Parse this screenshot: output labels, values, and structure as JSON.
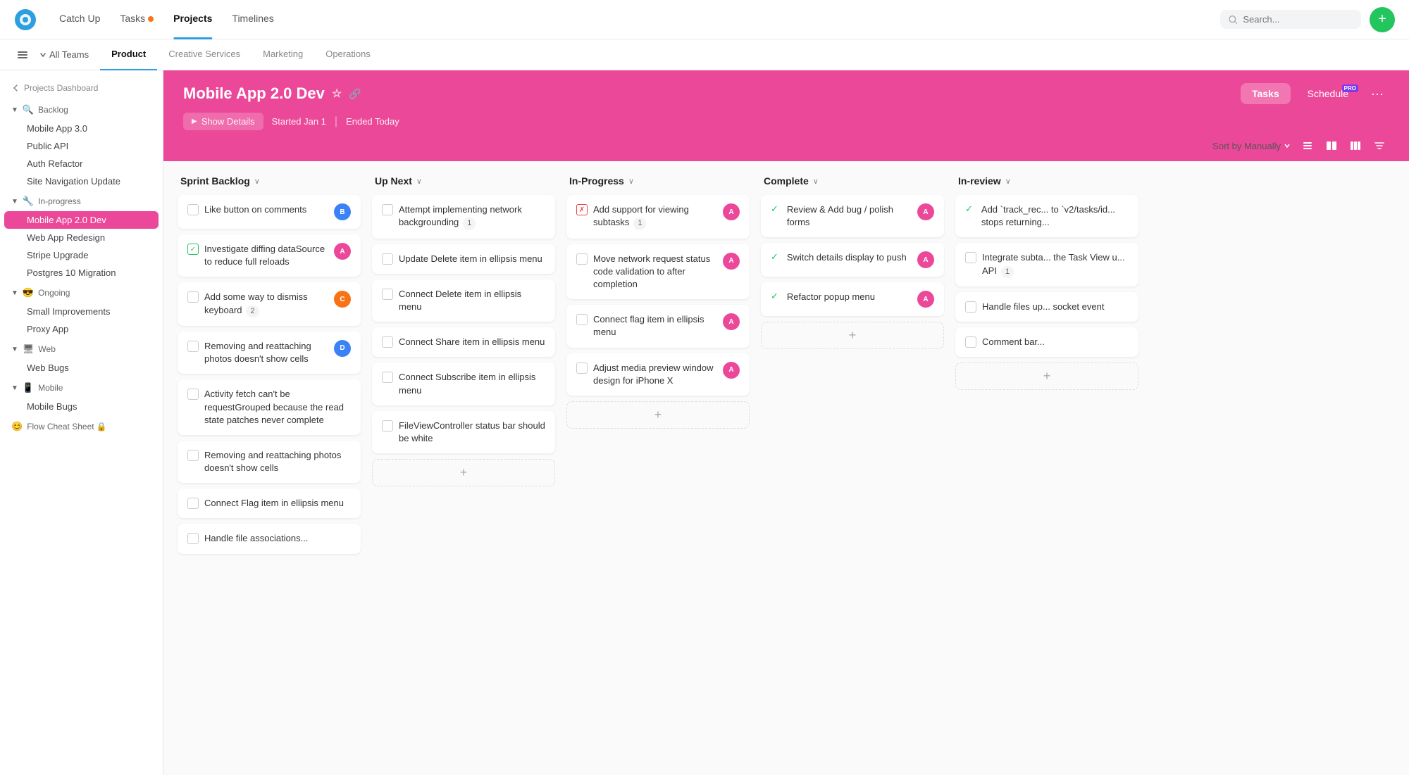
{
  "topNav": {
    "logoAlt": "app-logo",
    "links": [
      {
        "label": "Catch Up",
        "active": false,
        "badge": false
      },
      {
        "label": "Tasks",
        "active": false,
        "badge": true
      },
      {
        "label": "Projects",
        "active": true,
        "badge": false
      },
      {
        "label": "Timelines",
        "active": false,
        "badge": false
      }
    ],
    "searchPlaceholder": "Search...",
    "addButtonLabel": "+"
  },
  "teamBar": {
    "allTeamsLabel": "All Teams",
    "tabs": [
      {
        "label": "Product",
        "active": true
      },
      {
        "label": "Creative Services",
        "active": false
      },
      {
        "label": "Marketing",
        "active": false
      },
      {
        "label": "Operations",
        "active": false
      }
    ]
  },
  "sidebar": {
    "backLabel": "Projects Dashboard",
    "sections": [
      {
        "icon": "🔍",
        "label": "Backlog",
        "items": [
          "Mobile App 3.0",
          "Public API",
          "Auth Refactor",
          "Site Navigation Update"
        ]
      },
      {
        "icon": "🔧",
        "label": "In-progress",
        "items": [
          "Mobile App 2.0 Dev",
          "Web App Redesign",
          "Stripe Upgrade",
          "Postgres 10 Migration"
        ],
        "activeItem": "Mobile App 2.0 Dev"
      },
      {
        "icon": "😎",
        "label": "Ongoing",
        "items": [
          "Small Improvements",
          "Proxy App"
        ]
      },
      {
        "icon": "🖥",
        "label": "Web",
        "items": [
          "Web Bugs"
        ]
      },
      {
        "icon": "📱",
        "label": "Mobile",
        "items": [
          "Mobile Bugs"
        ]
      },
      {
        "icon": "😊",
        "label": "Flow Cheat Sheet 🔒",
        "items": []
      }
    ]
  },
  "project": {
    "title": "Mobile App 2.0 Dev",
    "startedLabel": "Started Jan 1",
    "endedLabel": "Ended Today",
    "showDetailsLabel": "Show Details",
    "tasksLabel": "Tasks",
    "scheduleLabel": "Schedule",
    "proLabel": "PRO",
    "sortLabel": "Sort by Manually"
  },
  "board": {
    "columns": [
      {
        "title": "Sprint Backlog",
        "cards": [
          {
            "text": "Like button on comments",
            "checked": false,
            "avatarColor": "#3b82f6",
            "avatarInitial": "B"
          },
          {
            "text": "Investigate diffing dataSource to reduce full reloads",
            "checked": true,
            "avatarColor": "#ec4899",
            "avatarInitial": "A"
          },
          {
            "text": "Add some way to dismiss keyboard",
            "checked": false,
            "badgeCount": "2",
            "avatarColor": "#f97316",
            "avatarInitial": "C"
          },
          {
            "text": "Removing and reattaching photos doesn't show cells",
            "checked": false,
            "avatarColor": "#3b82f6",
            "avatarInitial": "D"
          },
          {
            "text": "Activity fetch can't be requestGrouped because the read state patches never complete",
            "checked": false,
            "avatarColor": null
          },
          {
            "text": "Removing and reattaching photos doesn't show cells",
            "checked": false,
            "avatarColor": null
          },
          {
            "text": "Connect Flag item in ellipsis menu",
            "checked": false,
            "avatarColor": null
          },
          {
            "text": "Handle file associations...",
            "checked": false,
            "avatarColor": null
          }
        ]
      },
      {
        "title": "Up Next",
        "cards": [
          {
            "text": "Attempt implementing network backgrounding",
            "checked": false,
            "badgeCount": "1",
            "avatarColor": null
          },
          {
            "text": "Update Delete item in ellipsis menu",
            "checked": false,
            "avatarColor": null
          },
          {
            "text": "Connect Delete item in ellipsis menu",
            "checked": false,
            "avatarColor": null
          },
          {
            "text": "Connect Share item in ellipsis menu",
            "checked": false,
            "avatarColor": null
          },
          {
            "text": "Connect Subscribe item in ellipsis menu",
            "checked": false,
            "avatarColor": null
          },
          {
            "text": "FileViewController status bar should be white",
            "checked": false,
            "avatarColor": null
          }
        ]
      },
      {
        "title": "In-Progress",
        "cards": [
          {
            "text": "Add support for viewing subtasks",
            "redCheck": true,
            "badgeCount": "1",
            "avatarColor": "#ec4899",
            "avatarInitial": "A"
          },
          {
            "text": "Move network request status code validation to after completion",
            "checked": false,
            "avatarColor": "#ec4899",
            "avatarInitial": "A"
          },
          {
            "text": "Connect flag item in ellipsis menu",
            "checked": false,
            "avatarColor": "#ec4899",
            "avatarInitial": "A"
          },
          {
            "text": "Adjust media preview window design for iPhone X",
            "checked": false,
            "avatarColor": "#ec4899",
            "avatarInitial": "A"
          }
        ]
      },
      {
        "title": "Complete",
        "cards": [
          {
            "text": "Review & Add bug / polish forms",
            "complete": true,
            "avatarColor": "#ec4899",
            "avatarInitial": "A"
          },
          {
            "text": "Switch details display to push",
            "complete": true,
            "avatarColor": "#ec4899",
            "avatarInitial": "A"
          },
          {
            "text": "Refactor popup menu",
            "complete": true,
            "avatarColor": "#ec4899",
            "avatarInitial": "A"
          }
        ]
      },
      {
        "title": "In-review",
        "cards": [
          {
            "text": "Add `track_rec... to `v2/tasks/id... stops returning...",
            "complete": true,
            "avatarColor": null
          },
          {
            "text": "Integrate subta... the Task View u... API",
            "checked": false,
            "badgeCount": "1",
            "avatarColor": null
          },
          {
            "text": "Handle files up... socket event",
            "checked": false,
            "avatarColor": null
          },
          {
            "text": "Comment bar...",
            "checked": false,
            "avatarColor": null
          }
        ]
      }
    ]
  }
}
